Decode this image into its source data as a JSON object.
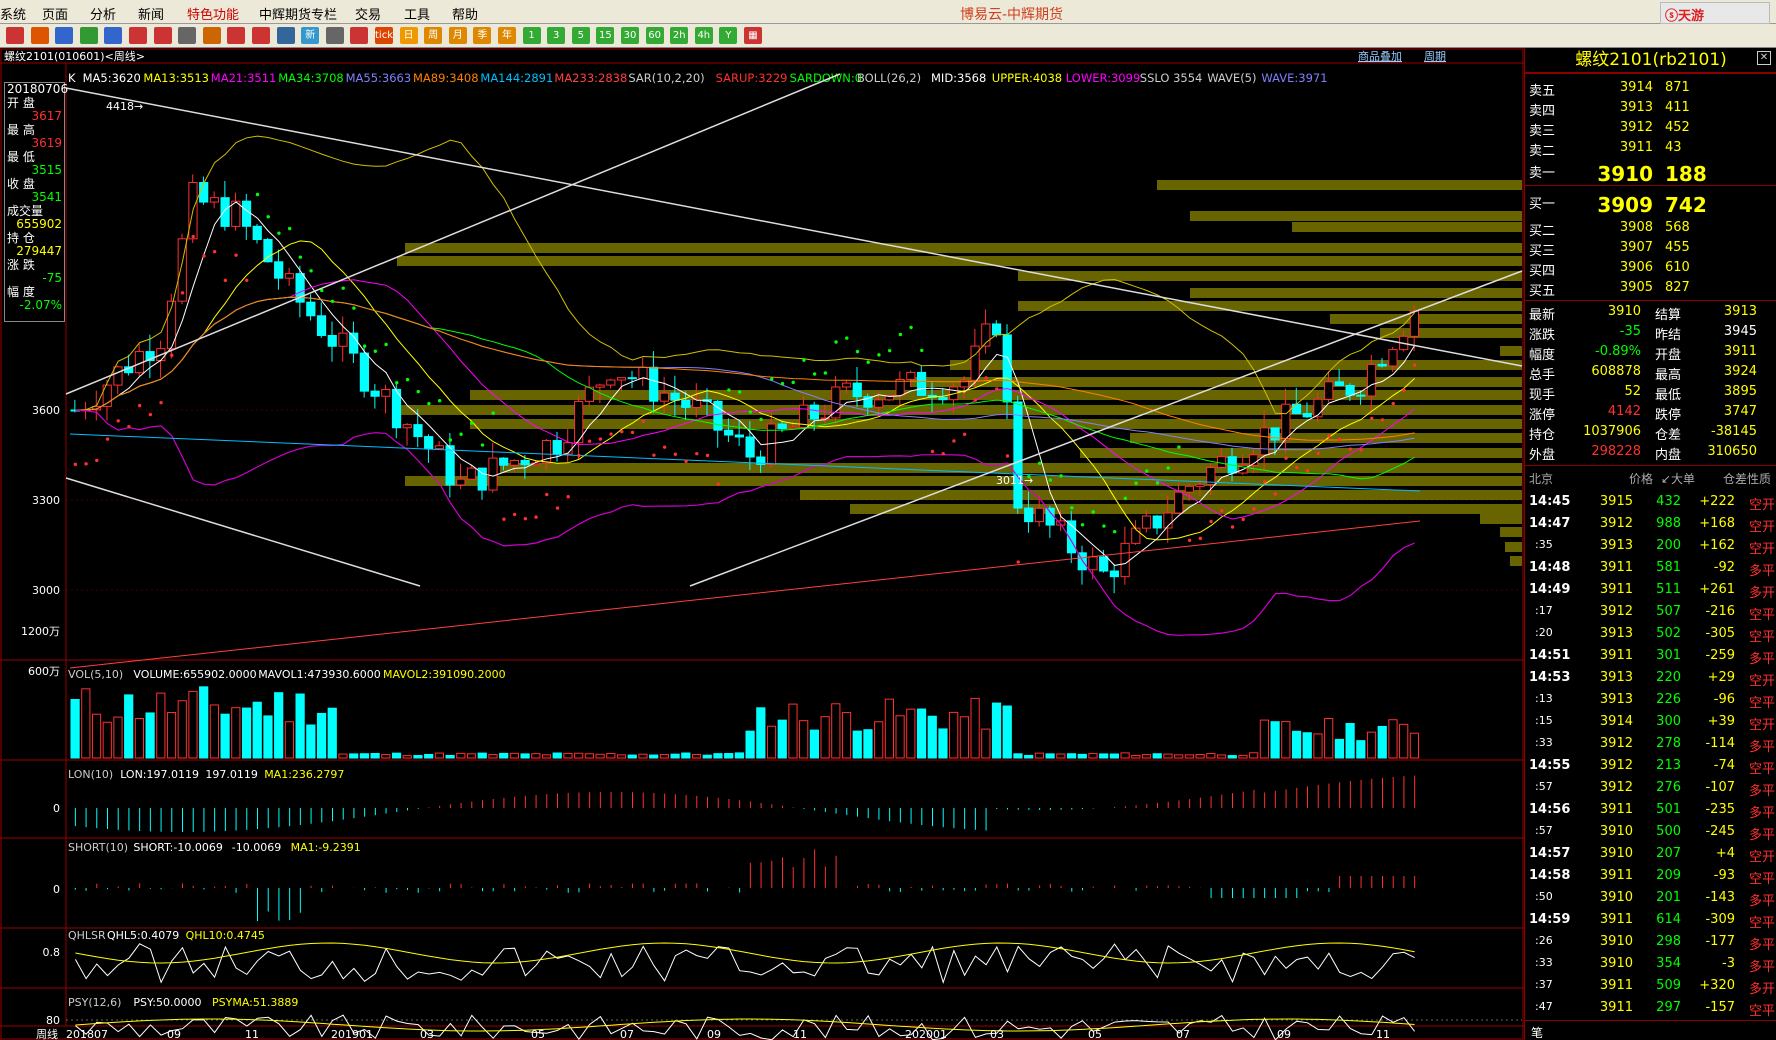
{
  "app": {
    "title": "博易云-中辉期货",
    "brand": "ⓢ天游"
  },
  "menu": [
    "系统",
    "页面",
    "分析",
    "新闻",
    "特色功能",
    "中辉期货专栏",
    "交易",
    "工具",
    "帮助"
  ],
  "toolbar": {
    "icons": [
      "home-icon",
      "back-icon",
      "forward-icon",
      "refresh-icon",
      "search-icon",
      "zoom-in-icon",
      "zoom-out-icon",
      "stop-icon",
      "pencil-icon",
      "line-icon",
      "filter-icon",
      "arrows-icon",
      "new-icon",
      "table-icon",
      "chart-icon",
      "tick-icon",
      "daily-icon",
      "week-icon",
      "month-icon",
      "season-icon",
      "year-icon",
      "1min-icon",
      "3min-icon",
      "5min-icon",
      "15min-icon",
      "30min-icon",
      "60min-icon",
      "2h-icon",
      "4h-icon",
      "y-icon",
      "calendar-icon"
    ],
    "labels": [
      "",
      "",
      "",
      "",
      "",
      "",
      "",
      "",
      "",
      "",
      "",
      "",
      "新",
      "",
      "",
      "tick",
      "日",
      "周",
      "月",
      "季",
      "年",
      "1",
      "3",
      "5",
      "15",
      "30",
      "60",
      "2h",
      "4h",
      "Y",
      "▦"
    ]
  },
  "chart": {
    "symbol": "螺纹2101(010601)<周线>",
    "topbar_right": [
      "商品叠加",
      "周期"
    ],
    "ma_line": [
      {
        "t": "K",
        "c": "#ffffff"
      },
      {
        "t": "MA5:3620",
        "c": "#ffffff"
      },
      {
        "t": "MA13:3513",
        "c": "#ffff00"
      },
      {
        "t": "MA21:3511",
        "c": "#ff00ff"
      },
      {
        "t": "MA34:3708",
        "c": "#00ff00"
      },
      {
        "t": "MA55:3663",
        "c": "#8080ff"
      },
      {
        "t": "MA89:3408",
        "c": "#ff8000"
      },
      {
        "t": "MA144:2891",
        "c": "#00bfff"
      },
      {
        "t": "MA233:2838",
        "c": "#ff4040"
      },
      {
        "t": "SAR(10,2,20)",
        "c": "#cccccc"
      },
      {
        "t": "SARUP:3229",
        "c": "#ff3030"
      },
      {
        "t": "SARDOWN:0",
        "c": "#00ff00"
      },
      {
        "t": "BOLL(26,2)",
        "c": "#cccccc"
      },
      {
        "t": "MID:3568",
        "c": "#ffffff"
      },
      {
        "t": "UPPER:4038",
        "c": "#ffff00"
      },
      {
        "t": "LOWER:3099",
        "c": "#ff00ff"
      },
      {
        "t": "SSLO 3554",
        "c": "#cccccc"
      },
      {
        "t": "WAVE(5)",
        "c": "#cccccc"
      },
      {
        "t": "WAVE:3971",
        "c": "#8080ff"
      }
    ],
    "info": [
      {
        "t": "20180706",
        "c": "#ffffff"
      },
      {
        "t": "开  盘",
        "c": "#ffffff"
      },
      {
        "t": "3617",
        "c": "#ff3030"
      },
      {
        "t": "最  高",
        "c": "#ffffff"
      },
      {
        "t": "3619",
        "c": "#ff3030"
      },
      {
        "t": "最  低",
        "c": "#ffffff"
      },
      {
        "t": "3515",
        "c": "#00ff00"
      },
      {
        "t": "收  盘",
        "c": "#ffffff"
      },
      {
        "t": "3541",
        "c": "#00ff00"
      },
      {
        "t": "成交量",
        "c": "#ffffff"
      },
      {
        "t": "655902",
        "c": "#ffff00"
      },
      {
        "t": "持  仓",
        "c": "#ffffff"
      },
      {
        "t": "279447",
        "c": "#ffff00"
      },
      {
        "t": "涨  跌",
        "c": "#ffffff"
      },
      {
        "t": "-75",
        "c": "#00ff00"
      },
      {
        "t": "幅  度",
        "c": "#ffffff"
      },
      {
        "t": "-2.07%",
        "c": "#00ff00"
      }
    ],
    "yticks": [
      "3600",
      "3300",
      "3000"
    ],
    "annot_high": "4418",
    "annot_low": "3011",
    "vol_label": [
      {
        "t": "VOL(5,10)",
        "c": "#cccccc"
      },
      {
        "t": "VOLUME:655902.0000",
        "c": "#ffffff"
      },
      {
        "t": "MAVOL1:473930.6000",
        "c": "#ffffff"
      },
      {
        "t": "MAVOL2:391090.2000",
        "c": "#ffff00"
      }
    ],
    "vol_ticks": [
      "1200万",
      "600万"
    ],
    "lon_label": [
      {
        "t": "LON(10)",
        "c": "#cccccc"
      },
      {
        "t": "LON:197.0119",
        "c": "#ffffff"
      },
      {
        "t": "197.0119",
        "c": "#ffffff"
      },
      {
        "t": "MA1:236.2797",
        "c": "#ffff00"
      }
    ],
    "short_label": [
      {
        "t": "SHORT(10)",
        "c": "#cccccc"
      },
      {
        "t": "SHORT:-10.0069",
        "c": "#ffffff"
      },
      {
        "t": "-10.0069",
        "c": "#ffffff"
      },
      {
        "t": "MA1:-9.2391",
        "c": "#ffff00"
      }
    ],
    "qhlsr_label": [
      {
        "t": "QHLSR",
        "c": "#cccccc"
      },
      {
        "t": "QHL5:0.4079",
        "c": "#ffffff"
      },
      {
        "t": "QHL10:0.4745",
        "c": "#ffff00"
      }
    ],
    "psy_label": [
      {
        "t": "PSY(12,6)",
        "c": "#cccccc"
      },
      {
        "t": "PSY:50.0000",
        "c": "#ffffff"
      },
      {
        "t": "PSYMA:51.3889",
        "c": "#ffff00"
      }
    ],
    "zero": "0",
    "qhl_tick": "0.8",
    "psy_tick": "80",
    "xaxis": [
      "周线",
      "201807",
      "09",
      "11",
      "201901",
      "03",
      "05",
      "07",
      "09",
      "11",
      "202001",
      "03",
      "05",
      "07",
      "09",
      "11"
    ]
  },
  "quote": {
    "title": "螺纹2101(rb2101)",
    "asks": [
      [
        "卖五",
        "3914",
        "871"
      ],
      [
        "卖四",
        "3913",
        "411"
      ],
      [
        "卖三",
        "3912",
        "452"
      ],
      [
        "卖二",
        "3911",
        "43"
      ],
      [
        "卖一",
        "3910",
        "188"
      ]
    ],
    "bids": [
      [
        "买一",
        "3909",
        "742"
      ],
      [
        "买二",
        "3908",
        "568"
      ],
      [
        "买三",
        "3907",
        "455"
      ],
      [
        "买四",
        "3906",
        "610"
      ],
      [
        "买五",
        "3905",
        "827"
      ]
    ],
    "stats": [
      [
        {
          "t": "最新",
          "c": "#fff"
        },
        {
          "t": "3910",
          "c": "#ffff00"
        },
        {
          "t": "结算",
          "c": "#fff"
        },
        {
          "t": "3913",
          "c": "#ffff00"
        }
      ],
      [
        {
          "t": "涨跌",
          "c": "#fff"
        },
        {
          "t": "-35",
          "c": "#00ff00"
        },
        {
          "t": "昨结",
          "c": "#fff"
        },
        {
          "t": "3945",
          "c": "#fff"
        }
      ],
      [
        {
          "t": "幅度",
          "c": "#fff"
        },
        {
          "t": "-0.89%",
          "c": "#00ff00"
        },
        {
          "t": "开盘",
          "c": "#fff"
        },
        {
          "t": "3911",
          "c": "#ffff00"
        }
      ],
      [
        {
          "t": "总手",
          "c": "#fff"
        },
        {
          "t": "608878",
          "c": "#ffff00"
        },
        {
          "t": "最高",
          "c": "#fff"
        },
        {
          "t": "3924",
          "c": "#ffff00"
        }
      ],
      [
        {
          "t": "现手",
          "c": "#fff"
        },
        {
          "t": "52",
          "c": "#ffff00"
        },
        {
          "t": "最低",
          "c": "#fff"
        },
        {
          "t": "3895",
          "c": "#ffff00"
        }
      ],
      [
        {
          "t": "涨停",
          "c": "#fff"
        },
        {
          "t": "4142",
          "c": "#ff3030"
        },
        {
          "t": "跌停",
          "c": "#fff"
        },
        {
          "t": "3747",
          "c": "#ffff00"
        }
      ],
      [
        {
          "t": "持仓",
          "c": "#fff"
        },
        {
          "t": "1037906",
          "c": "#ffff00"
        },
        {
          "t": "仓差",
          "c": "#fff"
        },
        {
          "t": "-38145",
          "c": "#ffff00"
        }
      ],
      [
        {
          "t": "外盘",
          "c": "#fff"
        },
        {
          "t": "298228",
          "c": "#ff3030"
        },
        {
          "t": "内盘",
          "c": "#fff"
        },
        {
          "t": "310650",
          "c": "#ffff00"
        }
      ]
    ],
    "trade_head": [
      "北京",
      "价格",
      "↙大单",
      "仓差",
      "性质"
    ],
    "trades": [
      [
        "14:45",
        "3915",
        "432",
        "+222",
        "空开"
      ],
      [
        "14:47",
        "3912",
        "988",
        "+168",
        "空开"
      ],
      [
        ":35",
        "3913",
        "200",
        "+162",
        "空开"
      ],
      [
        "14:48",
        "3911",
        "581",
        "-92",
        "多平"
      ],
      [
        "14:49",
        "3911",
        "511",
        "+261",
        "多开"
      ],
      [
        ":17",
        "3912",
        "507",
        "-216",
        "空平"
      ],
      [
        ":20",
        "3913",
        "502",
        "-305",
        "空平"
      ],
      [
        "14:51",
        "3911",
        "301",
        "-259",
        "多平"
      ],
      [
        "14:53",
        "3913",
        "220",
        "+29",
        "空开"
      ],
      [
        ":13",
        "3913",
        "226",
        "-96",
        "空平"
      ],
      [
        ":15",
        "3914",
        "300",
        "+39",
        "空开"
      ],
      [
        ":33",
        "3912",
        "278",
        "-114",
        "多平"
      ],
      [
        "14:55",
        "3912",
        "213",
        "-74",
        "空平"
      ],
      [
        ":57",
        "3912",
        "276",
        "-107",
        "多平"
      ],
      [
        "14:56",
        "3911",
        "501",
        "-235",
        "多平"
      ],
      [
        ":57",
        "3910",
        "500",
        "-245",
        "多平"
      ],
      [
        "14:57",
        "3910",
        "207",
        "+4",
        "空开"
      ],
      [
        "14:58",
        "3911",
        "209",
        "-93",
        "空平"
      ],
      [
        ":50",
        "3910",
        "201",
        "-143",
        "多平"
      ],
      [
        "14:59",
        "3911",
        "614",
        "-309",
        "空平"
      ],
      [
        ":26",
        "3910",
        "298",
        "-177",
        "多平"
      ],
      [
        ":33",
        "3910",
        "354",
        "-3",
        "多平"
      ],
      [
        ":37",
        "3911",
        "509",
        "+320",
        "多开"
      ],
      [
        ":47",
        "3911",
        "297",
        "-157",
        "空平"
      ]
    ],
    "bottom": "笔"
  }
}
